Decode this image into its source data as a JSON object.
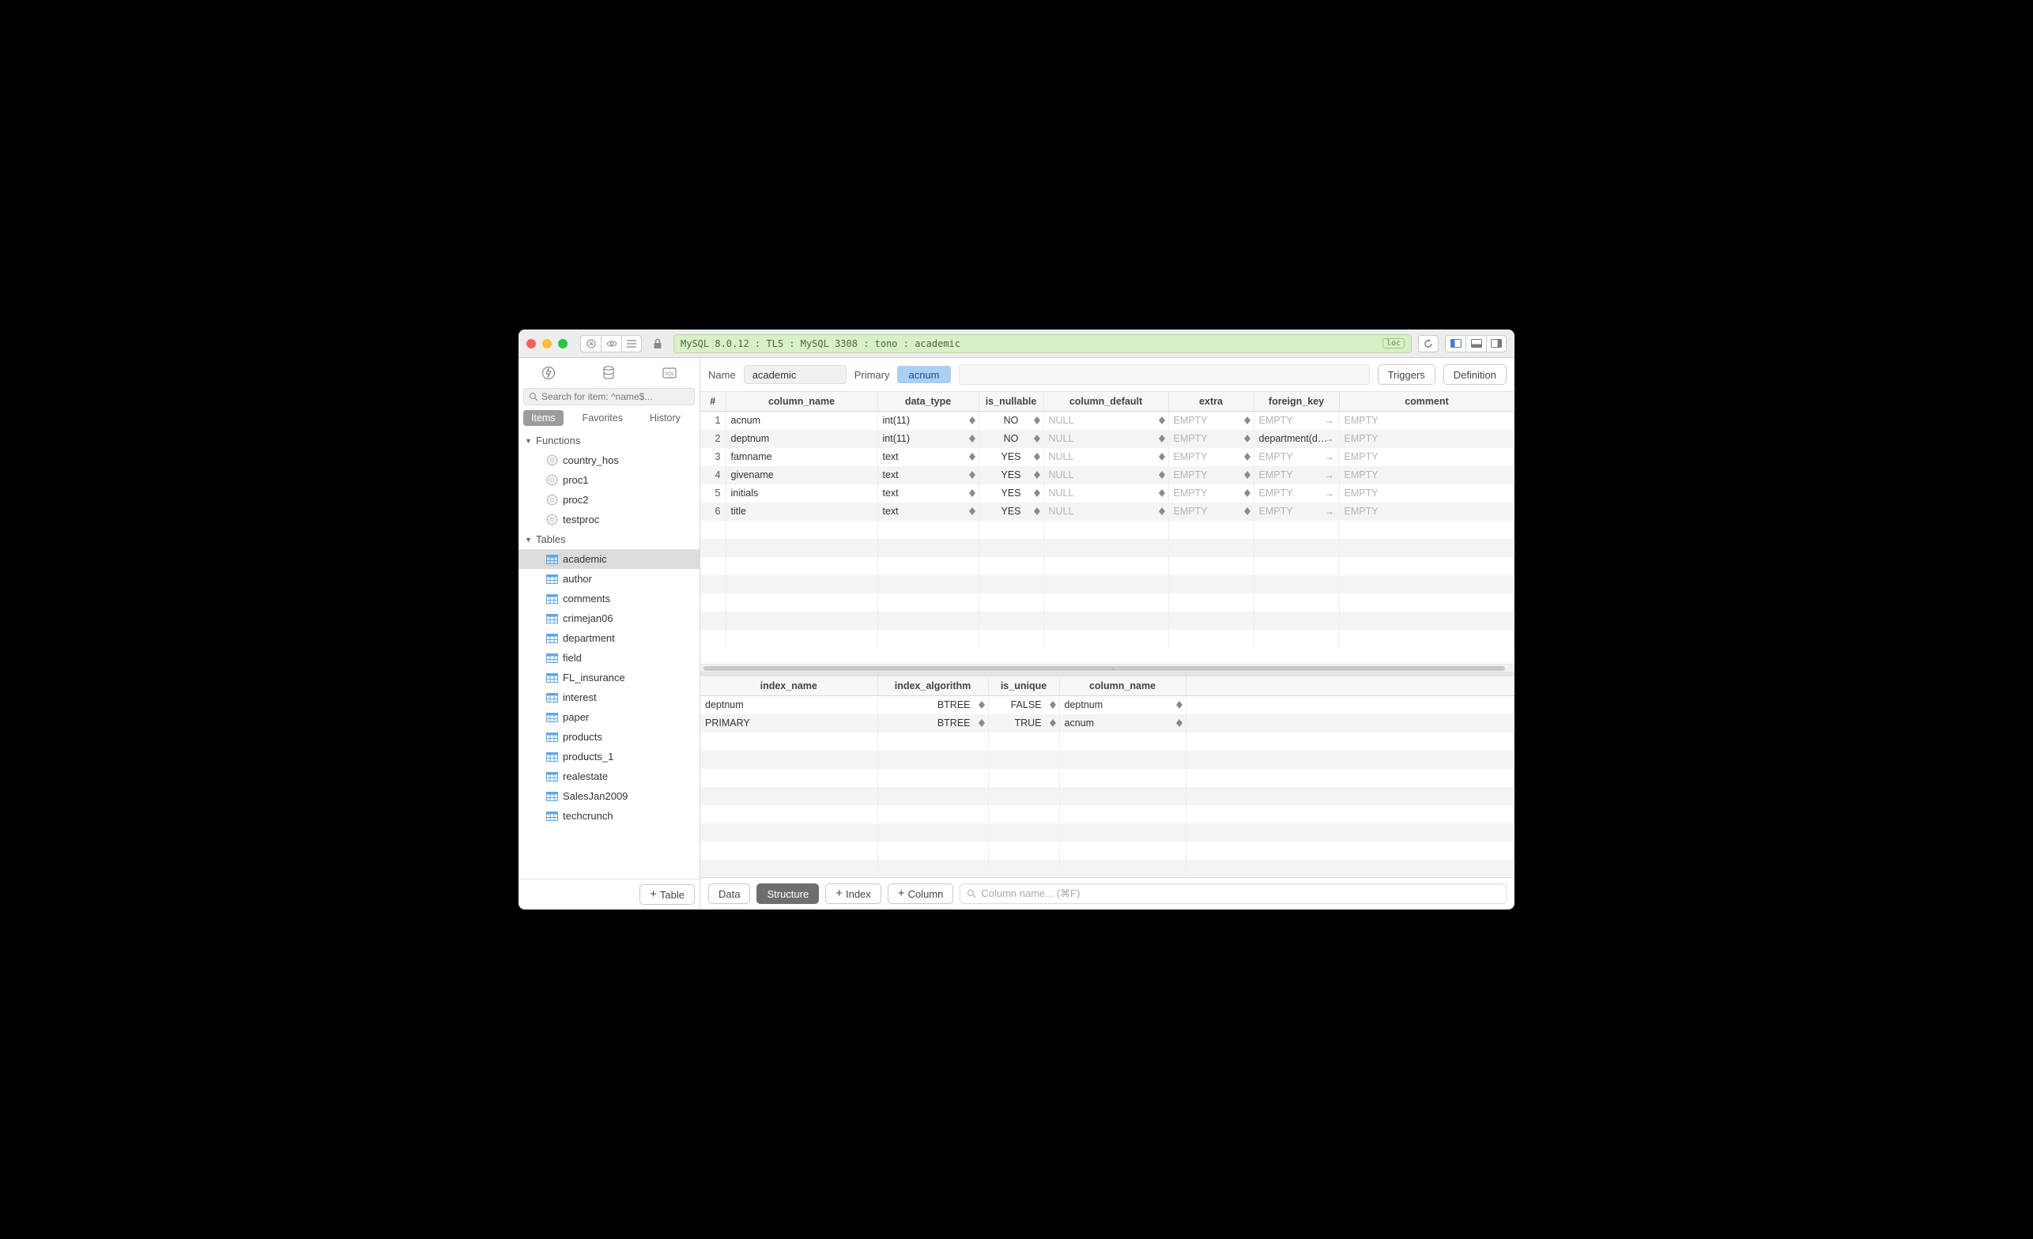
{
  "connection": {
    "text": "MySQL 8.0.12 : TLS : MySQL 3308 : tono : academic",
    "loc_badge": "loc"
  },
  "sidebar": {
    "search_placeholder": "Search for item: ^name$...",
    "tabs": {
      "items": "Items",
      "favorites": "Favorites",
      "history": "History"
    },
    "sections": {
      "functions": {
        "label": "Functions",
        "items": [
          "country_hos",
          "proc1",
          "proc2",
          "testproc"
        ]
      },
      "tables": {
        "label": "Tables",
        "items": [
          "academic",
          "author",
          "comments",
          "crimejan06",
          "department",
          "field",
          "FL_insurance",
          "interest",
          "paper",
          "products",
          "products_1",
          "realestate",
          "SalesJan2009",
          "techcrunch"
        ],
        "selected": "academic"
      }
    },
    "add_table_btn": "Table"
  },
  "header": {
    "name_label": "Name",
    "name_value": "academic",
    "primary_label": "Primary",
    "primary_value": "acnum",
    "triggers_btn": "Triggers",
    "definition_btn": "Definition"
  },
  "columns_table": {
    "headers": {
      "idx": "#",
      "name": "column_name",
      "type": "data_type",
      "nullable": "is_nullable",
      "default_": "column_default",
      "extra": "extra",
      "fk": "foreign_key",
      "comment": "comment"
    },
    "empty": "EMPTY",
    "null": "NULL",
    "rows": [
      {
        "n": 1,
        "name": "acnum",
        "type": "int(11)",
        "nullable": "NO",
        "fk": ""
      },
      {
        "n": 2,
        "name": "deptnum",
        "type": "int(11)",
        "nullable": "NO",
        "fk": "department(d…"
      },
      {
        "n": 3,
        "name": "famname",
        "type": "text",
        "nullable": "YES",
        "fk": ""
      },
      {
        "n": 4,
        "name": "givename",
        "type": "text",
        "nullable": "YES",
        "fk": ""
      },
      {
        "n": 5,
        "name": "initials",
        "type": "text",
        "nullable": "YES",
        "fk": ""
      },
      {
        "n": 6,
        "name": "title",
        "type": "text",
        "nullable": "YES",
        "fk": ""
      }
    ]
  },
  "index_table": {
    "headers": {
      "name": "index_name",
      "algo": "index_algorithm",
      "unique": "is_unique",
      "col": "column_name"
    },
    "rows": [
      {
        "name": "deptnum",
        "algo": "BTREE",
        "unique": "FALSE",
        "col": "deptnum"
      },
      {
        "name": "PRIMARY",
        "algo": "BTREE",
        "unique": "TRUE",
        "col": "acnum"
      }
    ]
  },
  "bottom": {
    "data_btn": "Data",
    "structure_btn": "Structure",
    "index_btn": "Index",
    "column_btn": "Column",
    "filter_placeholder": "Column name... (⌘F)"
  }
}
